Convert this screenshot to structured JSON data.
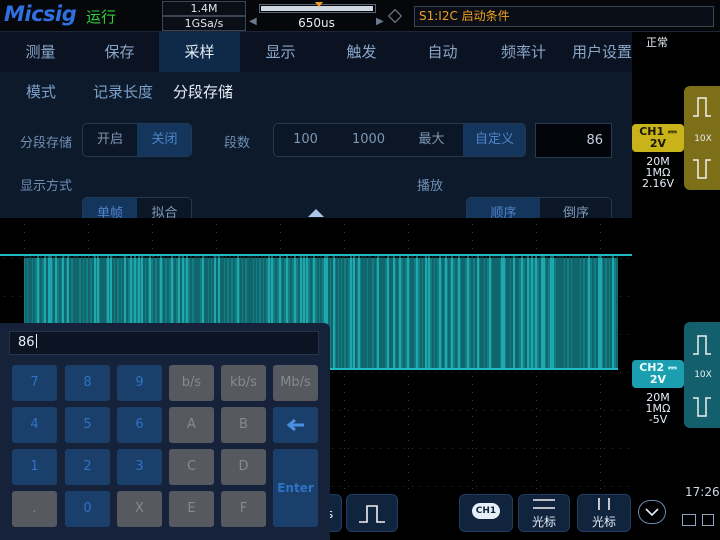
{
  "top_bar": {
    "logo": "Micsig",
    "run_state": "运行",
    "memory_depth": "1.4M",
    "sample_rate": "1GSa/s",
    "timebase": "650us",
    "trigger": "S1:I2C 启动条件"
  },
  "menu": {
    "tabs": [
      "测量",
      "保存",
      "采样",
      "显示",
      "触发",
      "自动",
      "频率计",
      "用户设置"
    ],
    "active_tab": "采样",
    "sub_tabs": [
      "模式",
      "记录长度",
      "分段存储"
    ],
    "active_sub_tab": "分段存储"
  },
  "segmented_storage": {
    "label": "分段存储",
    "options": [
      "开启",
      "关闭"
    ],
    "selected": "关闭"
  },
  "segment_count": {
    "label": "段数",
    "options": [
      "100",
      "1000",
      "最大",
      "自定义"
    ],
    "selected": "自定义",
    "value": "86"
  },
  "display_mode": {
    "label": "显示方式",
    "options": [
      "单帧",
      "拟合"
    ],
    "selected": "单帧"
  },
  "playback": {
    "label": "播放",
    "options": [
      "顺序",
      "倒序"
    ],
    "selected": "顺序"
  },
  "keypad": {
    "input_value": "86",
    "rows": [
      [
        "7",
        "8",
        "9",
        "b/s",
        "kb/s",
        "Mb/s"
      ],
      [
        "4",
        "5",
        "6",
        "A",
        "B"
      ],
      [
        "1",
        "2",
        "3",
        "C",
        "D"
      ],
      [
        ".",
        "0",
        "X",
        "E",
        "F"
      ]
    ],
    "enter": "Enter"
  },
  "right_panel": {
    "acq_status": "正常",
    "ch1": {
      "name": "CH1",
      "scale": "2V",
      "bandwidth": "20M",
      "impedance": "1MΩ",
      "offset": "2.16V",
      "probe": "10X",
      "color": "#c8b41a"
    },
    "ch2": {
      "name": "CH2",
      "scale": "2V",
      "bandwidth": "20M",
      "impedance": "1MΩ",
      "offset": "-5V",
      "probe": "10X",
      "color": "#1b9fb0"
    },
    "time": "17:26"
  },
  "bottom_bar": {
    "partial_label": "s",
    "ch1_label": "CH1",
    "cursor_h_label": "光标",
    "cursor_v_label": "光标"
  },
  "colors": {
    "waveform": "#1fb8c4",
    "waveform_fill": "#137e82",
    "accent": "#2f71c7"
  }
}
